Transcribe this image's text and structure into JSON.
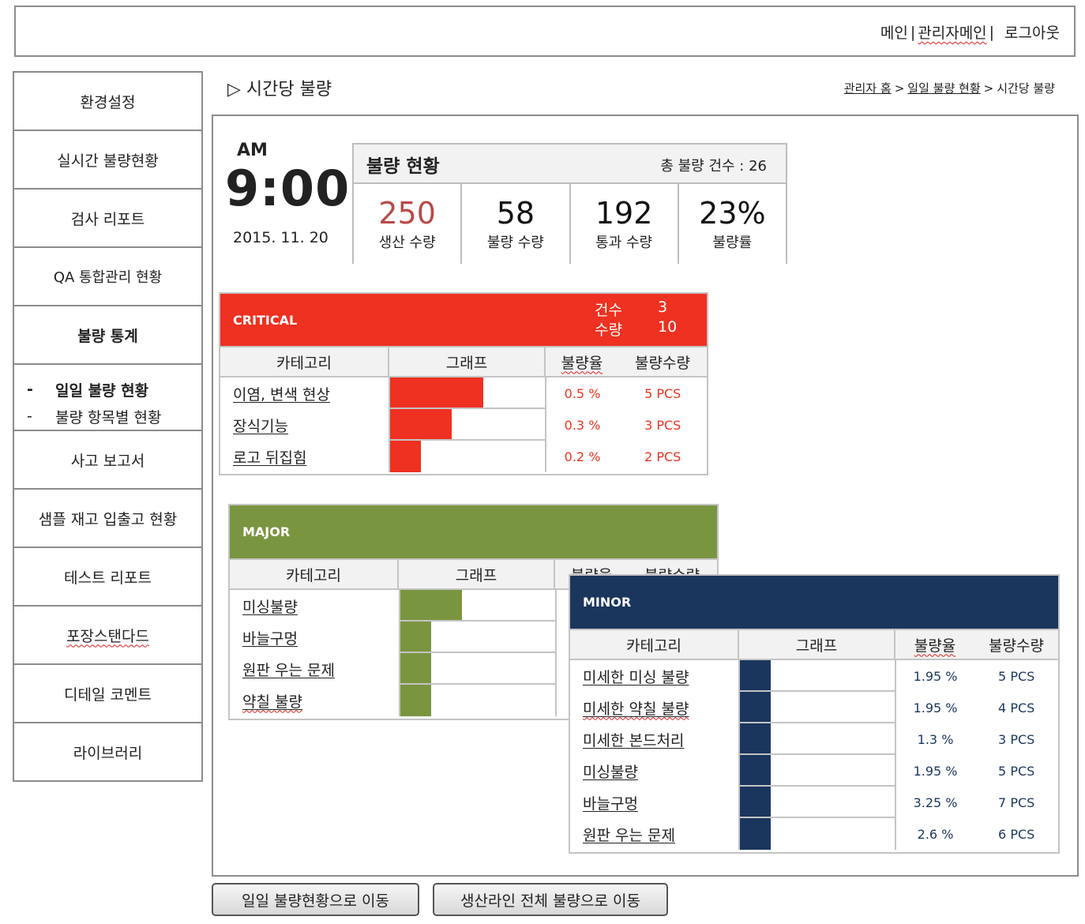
{
  "header": {
    "nav": [
      "메인",
      "관리자메인",
      "로그아웃"
    ],
    "sep": "|"
  },
  "sidebar": {
    "items": [
      {
        "label": "환경설정"
      },
      {
        "label": "실시간 불량현황"
      },
      {
        "label": "검사 리포트"
      },
      {
        "label": "QA 통합관리 현황"
      },
      {
        "label": "불량 통계",
        "active": true
      },
      {
        "label": "사고 보고서"
      },
      {
        "label": "샘플 재고 입출고 현황"
      },
      {
        "label": "테스트 리포트"
      },
      {
        "label": "포장스탠다드"
      },
      {
        "label": "디테일 코멘트"
      },
      {
        "label": "라이브러리"
      }
    ],
    "subitems": [
      {
        "dash": "-",
        "label": "일일 불량 현황",
        "active": true
      },
      {
        "dash": "-",
        "label": "불량 항목별 현황"
      }
    ]
  },
  "page": {
    "title": "▷ 시간당 불량",
    "breadcrumb": [
      "관리자 홈",
      "일일 불량 현황",
      "시간당 불량"
    ]
  },
  "clock": {
    "ampm": "AM",
    "time": "9:00",
    "date": "2015. 11. 20"
  },
  "status": {
    "title": "불량 현황",
    "total": "총 불량 건수 : 26",
    "cells": [
      {
        "value": "250",
        "label": "생산 수량"
      },
      {
        "value": "58",
        "label": "불량 수량"
      },
      {
        "value": "192",
        "label": "통과 수량"
      },
      {
        "value": "23%",
        "label": "불량률"
      }
    ]
  },
  "columns": {
    "category": "카테고리",
    "graph": "그래프",
    "rate": "불량율",
    "qty": "불량수량"
  },
  "critical": {
    "name": "CRITICAL",
    "count_label": "건수",
    "count": "3",
    "qty_label": "수량",
    "qty": "10",
    "color": "#ee3121",
    "rows": [
      {
        "category": "이염, 변색 현상",
        "bar": 0.6,
        "rate": "0.5 %",
        "qty": "5 PCS"
      },
      {
        "category": "장식기능",
        "bar": 0.4,
        "rate": "0.3 %",
        "qty": "3 PCS"
      },
      {
        "category": "로고 뒤집힘",
        "bar": 0.2,
        "rate": "0.2 %",
        "qty": "2 PCS"
      }
    ]
  },
  "major": {
    "name": "MAJOR",
    "color": "#7a9540",
    "rows": [
      {
        "category": "미싱불량",
        "bar": 0.4
      },
      {
        "category": "바늘구멍",
        "bar": 0.2
      },
      {
        "category": "원판 우는 문제",
        "bar": 0.2
      },
      {
        "category": "약칠 불량",
        "bar": 0.2
      }
    ]
  },
  "minor": {
    "name": "MINOR",
    "color": "#1b365d",
    "rows": [
      {
        "category": "미세한 미싱 불량",
        "bar": 0.2,
        "rate": "1.95 %",
        "qty": "5 PCS"
      },
      {
        "category": "미세한 약칠 불량",
        "bar": 0.2,
        "rate": "1.95 %",
        "qty": "4 PCS"
      },
      {
        "category": "미세한 본드처리",
        "bar": 0.2,
        "rate": "1.3 %",
        "qty": "3 PCS"
      },
      {
        "category": "미싱불량",
        "bar": 0.2,
        "rate": "1.95 %",
        "qty": "5 PCS"
      },
      {
        "category": "바늘구멍",
        "bar": 0.2,
        "rate": "3.25 %",
        "qty": "7 PCS"
      },
      {
        "category": "원판 우는 문제",
        "bar": 0.2,
        "rate": "2.6 %",
        "qty": "6 PCS"
      }
    ]
  },
  "buttons": {
    "daily": "일일 불량현황으로 이동",
    "all_lines": "생산라인 전체 불량으로 이동"
  }
}
